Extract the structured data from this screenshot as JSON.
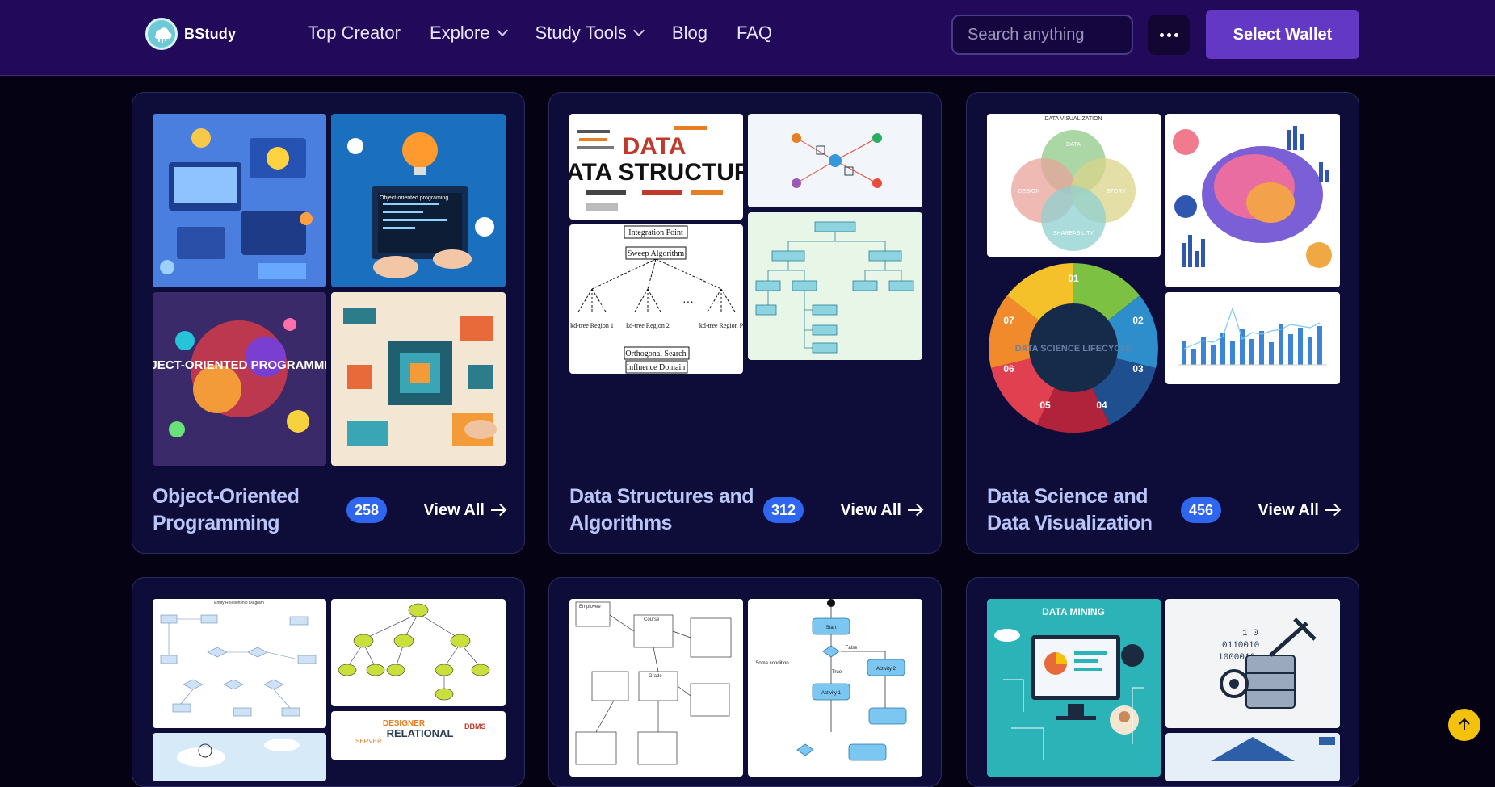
{
  "brand": {
    "name": "BStudy"
  },
  "nav": [
    {
      "label": "Top Creator"
    },
    {
      "label": "Explore"
    },
    {
      "label": "Study Tools"
    },
    {
      "label": "Blog"
    },
    {
      "label": "FAQ"
    }
  ],
  "search": {
    "placeholder": "Search anything"
  },
  "wallet": {
    "label": "Select Wallet"
  },
  "cards": [
    {
      "title": "Object-Oriented Programming",
      "count": "258",
      "view_all": "View All",
      "thumbs": [
        {
          "caption": "Object-oriented programing"
        },
        {
          "caption": "OBJECT-ORIENTED PROGRAMMING"
        }
      ]
    },
    {
      "title": "Data Structures and Algorithms",
      "count": "312",
      "view_all": "View All",
      "thumbs": [
        {
          "caption": "DATA STRUCTURE"
        },
        {
          "labels": [
            "Integration Point",
            "Sweep Algorithm",
            "kd-tree Region 1",
            "kd-tree Region 2",
            "kd-tree Region P",
            "Orthogonal Search",
            "Influence Domain"
          ]
        }
      ]
    },
    {
      "title": "Data Science and Data Visualization",
      "count": "456",
      "view_all": "View All",
      "thumbs": [
        {
          "caption": "DATA VISUALIZATION",
          "labels": [
            "DATA",
            "DESIGN",
            "STORY",
            "SHAREABILITY"
          ]
        },
        {
          "caption": "DATA SCIENCE LIFECYCLE",
          "labels": [
            "01",
            "02",
            "03",
            "04",
            "05",
            "06",
            "07"
          ]
        }
      ]
    },
    {
      "title": "",
      "count": "",
      "view_all": "",
      "thumbs": [
        {
          "caption": "Entity Relationship Diagram"
        }
      ]
    },
    {
      "title": "",
      "count": "",
      "view_all": "",
      "thumbs": [
        {
          "labels": [
            "Employee",
            "Course",
            "Grade",
            "Start",
            "Activity 1",
            "Activity 2",
            "Some condition",
            "False",
            "True"
          ]
        }
      ]
    },
    {
      "title": "",
      "count": "",
      "view_all": "",
      "thumbs": [
        {
          "caption": "DATA MINING"
        }
      ]
    }
  ]
}
